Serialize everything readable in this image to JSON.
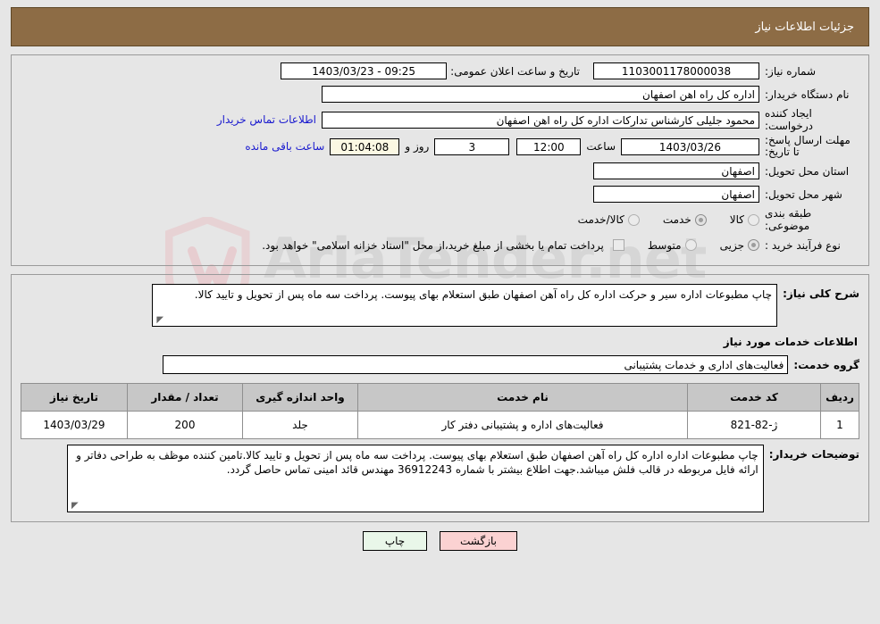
{
  "header": {
    "title": "جزئیات اطلاعات نیاز"
  },
  "form": {
    "need_number_label": "شماره نیاز:",
    "need_number_value": "1103001178000038",
    "announce_label": "تاریخ و ساعت اعلان عمومی:",
    "announce_value": "09:25 - 1403/03/23",
    "buyer_org_label": "نام دستگاه خریدار:",
    "buyer_org_value": "اداره کل راه اهن اصفهان",
    "creator_label": "ایجاد کننده درخواست:",
    "creator_value": "محمود جلیلی کارشناس تدارکات اداره کل راه اهن اصفهان",
    "contact_link": "اطلاعات تماس خریدار",
    "deadline_label": "مهلت ارسال پاسخ: تا تاریخ:",
    "deadline_date": "1403/03/26",
    "deadline_hour_label": "ساعت",
    "deadline_hour_value": "12:00",
    "remaining_days": "3",
    "days_and_label": "روز و",
    "remaining_time": "01:04:08",
    "remaining_suffix": "ساعت باقی مانده",
    "province_label": "استان محل تحویل:",
    "province_value": "اصفهان",
    "city_label": "شهر محل تحویل:",
    "city_value": "اصفهان",
    "category_label": "طبقه بندی موضوعی:",
    "category_options": [
      {
        "label": "کالا",
        "selected": false
      },
      {
        "label": "خدمت",
        "selected": true
      },
      {
        "label": "کالا/خدمت",
        "selected": false
      }
    ],
    "process_label": "نوع فرآیند خرید :",
    "process_options": [
      {
        "label": "جزیی",
        "selected": true
      },
      {
        "label": "متوسط",
        "selected": false
      }
    ],
    "treasury_checkbox_checked": false,
    "treasury_note": "پرداخت تمام یا بخشی از مبلغ خرید،از محل \"اسناد خزانه اسلامی\" خواهد بود."
  },
  "description": {
    "need_summary_label": "شرح کلی نیاز:",
    "need_summary_value": "چاپ مطبوعات اداره سیر و حرکت اداره کل راه آهن اصفهان طبق استعلام بهای پیوست. پرداخت سه ماه پس از تحویل و تایید کالا.",
    "services_section_title": "اطلاعات خدمات مورد نیاز",
    "service_group_label": "گروه خدمت:",
    "service_group_value": "فعالیت‌های اداری و خدمات پشتیبانی"
  },
  "table": {
    "columns": [
      "ردیف",
      "کد خدمت",
      "نام خدمت",
      "واحد اندازه گیری",
      "تعداد / مقدار",
      "تاریخ نیاز"
    ],
    "rows": [
      {
        "radif": "1",
        "code": "ژ-82-821",
        "name": "فعالیت‌های اداره و پشتیبانی دفتر کار",
        "unit": "جلد",
        "quantity": "200",
        "date": "1403/03/29"
      }
    ]
  },
  "buyer_notes": {
    "label": "توضیحات خریدار:",
    "value": "چاپ مطبوعات اداره اداره کل راه آهن اصفهان طبق استعلام بهای پیوست. پرداخت سه ماه پس از تحویل و تایید کالا.تامین کننده موظف به طراحی دفاتر و ارائه فایل مربوطه در قالب فلش میباشد.جهت اطلاع بیشتر با شماره 36912243 مهندس قائد امینی تماس حاصل گردد."
  },
  "footer": {
    "print_label": "چاپ",
    "back_label": "بازگشت"
  },
  "watermark": {
    "text": "AriaTender.net"
  }
}
